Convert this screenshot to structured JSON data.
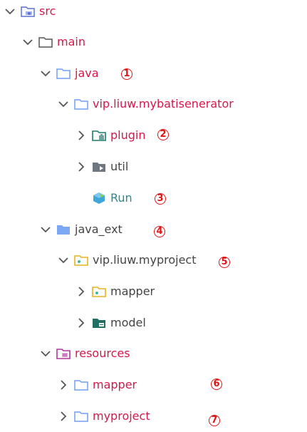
{
  "tree": {
    "nodes": [
      {
        "label": "src",
        "icon": "source-root-folder-icon",
        "expanded": true
      },
      {
        "label": "main",
        "icon": "folder-icon",
        "expanded": true
      },
      {
        "label": "java",
        "icon": "source-folder-icon",
        "expanded": true,
        "annotation": "1"
      },
      {
        "label": "vip.liuw.mybatisenerator",
        "icon": "package-folder-icon",
        "expanded": true
      },
      {
        "label": "plugin",
        "icon": "plugin-package-icon",
        "expanded": false,
        "annotation": "2"
      },
      {
        "label": "util",
        "icon": "package-icon",
        "expanded": false
      },
      {
        "label": "Run",
        "icon": "run-class-icon",
        "annotation": "3"
      },
      {
        "label": "java_ext",
        "icon": "source-folder-icon",
        "expanded": true,
        "annotation": "4"
      },
      {
        "label": "vip.liuw.myproject",
        "icon": "generated-package-icon",
        "expanded": true,
        "annotation": "5"
      },
      {
        "label": "mapper",
        "icon": "generated-package-icon",
        "expanded": false
      },
      {
        "label": "model",
        "icon": "model-package-icon",
        "expanded": false
      },
      {
        "label": "resources",
        "icon": "resources-folder-icon",
        "expanded": true
      },
      {
        "label": "mapper",
        "icon": "folder-icon",
        "expanded": false,
        "annotation": "6"
      },
      {
        "label": "myproject",
        "icon": "folder-icon",
        "expanded": false,
        "annotation": "7"
      }
    ]
  },
  "colors": {
    "label_red": "#d8164a",
    "label_gray": "#444444",
    "label_teal": "#2a8a8a",
    "annotation": "#e01414"
  }
}
